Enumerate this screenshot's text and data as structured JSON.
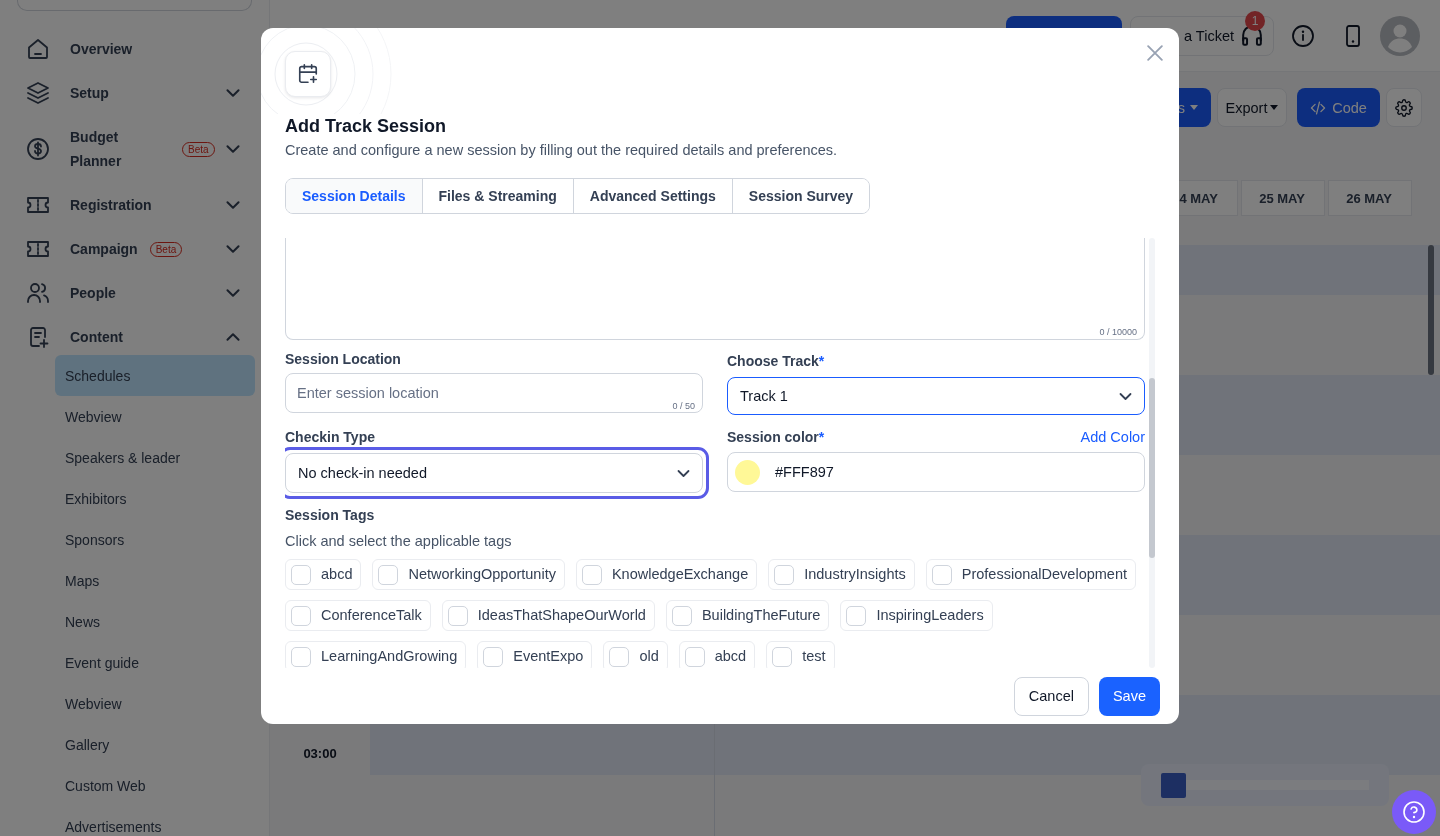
{
  "sidebar": {
    "items": [
      {
        "label": "Overview",
        "kind": "link"
      },
      {
        "label": "Setup",
        "kind": "group",
        "expanded": false
      },
      {
        "label": "Budget Planner",
        "kind": "group",
        "expanded": false,
        "badge": "Beta"
      },
      {
        "label": "Registration",
        "kind": "group",
        "expanded": false
      },
      {
        "label": "Campaign",
        "kind": "group",
        "expanded": false,
        "badge": "Beta"
      },
      {
        "label": "People",
        "kind": "group",
        "expanded": false
      },
      {
        "label": "Content",
        "kind": "group",
        "expanded": true,
        "children": [
          {
            "label": "Schedules",
            "selected": true
          },
          {
            "label": "Webview",
            "selected": false
          },
          {
            "label": "Speakers & leader",
            "selected": false
          },
          {
            "label": "Exhibitors",
            "selected": false
          },
          {
            "label": "Sponsors",
            "selected": false
          },
          {
            "label": "Maps",
            "selected": false
          },
          {
            "label": "News",
            "selected": false
          },
          {
            "label": "Event guide",
            "selected": false
          },
          {
            "label": "Webview",
            "selected": false
          },
          {
            "label": "Gallery",
            "selected": false
          },
          {
            "label": "Custom Web",
            "selected": false
          },
          {
            "label": "Advertisements",
            "selected": false
          }
        ]
      }
    ]
  },
  "top_bar": {
    "ticket_button": "a Ticket",
    "notification_count": "1"
  },
  "toolbar": {
    "buttons": [
      {
        "kind": "primary-dropdown",
        "label": "s"
      },
      {
        "kind": "dropdown",
        "label": "Export"
      },
      {
        "kind": "code",
        "label": "Code"
      },
      {
        "kind": "settings"
      }
    ]
  },
  "calendar": {
    "day_headers": [
      "4 MAY",
      "25 MAY",
      "26 MAY"
    ],
    "time_labels": [
      "03:00"
    ]
  },
  "modal": {
    "title": "Add Track Session",
    "subtitle": "Create and configure a new session by filling out the required details and preferences.",
    "tabs": [
      {
        "label": "Session Details",
        "selected": true
      },
      {
        "label": "Files & Streaming",
        "selected": false
      },
      {
        "label": "Advanced Settings",
        "selected": false
      },
      {
        "label": "Session Survey",
        "selected": false
      }
    ],
    "description": {
      "counter": "0 / 10000"
    },
    "session_location": {
      "label": "Session Location",
      "placeholder": "Enter session location",
      "counter": "0 / 50"
    },
    "choose_track": {
      "label": "Choose Track",
      "required_mark": "*",
      "value": "Track 1",
      "hovered": true,
      "focused": false
    },
    "checkin_type": {
      "label": "Checkin Type",
      "value": "No check-in needed",
      "hovered": false,
      "focused": true
    },
    "session_color": {
      "label": "Session color",
      "required_mark": "*",
      "link": "Add Color",
      "value": "#FFF897",
      "color": "#fff897"
    },
    "session_tags": {
      "label": "Session Tags",
      "hint": "Click and select the applicable tags",
      "tags": [
        {
          "label": "abcd",
          "checked": false
        },
        {
          "label": "NetworkingOpportunity",
          "checked": false
        },
        {
          "label": "KnowledgeExchange",
          "checked": false
        },
        {
          "label": "IndustryInsights",
          "checked": false
        },
        {
          "label": "ProfessionalDevelopment",
          "checked": false
        },
        {
          "label": "ConferenceTalk",
          "checked": false
        },
        {
          "label": "IdeasThatShapeOurWorld",
          "checked": false
        },
        {
          "label": "BuildingTheFuture",
          "checked": false
        },
        {
          "label": "InspiringLeaders",
          "checked": false
        },
        {
          "label": "LearningAndGrowing",
          "checked": false
        },
        {
          "label": "EventExpo",
          "checked": false
        },
        {
          "label": "old",
          "checked": false
        },
        {
          "label": "abcd",
          "checked": false
        },
        {
          "label": "test",
          "checked": false
        }
      ]
    },
    "buttons": {
      "cancel": "Cancel",
      "save": "Save"
    }
  }
}
